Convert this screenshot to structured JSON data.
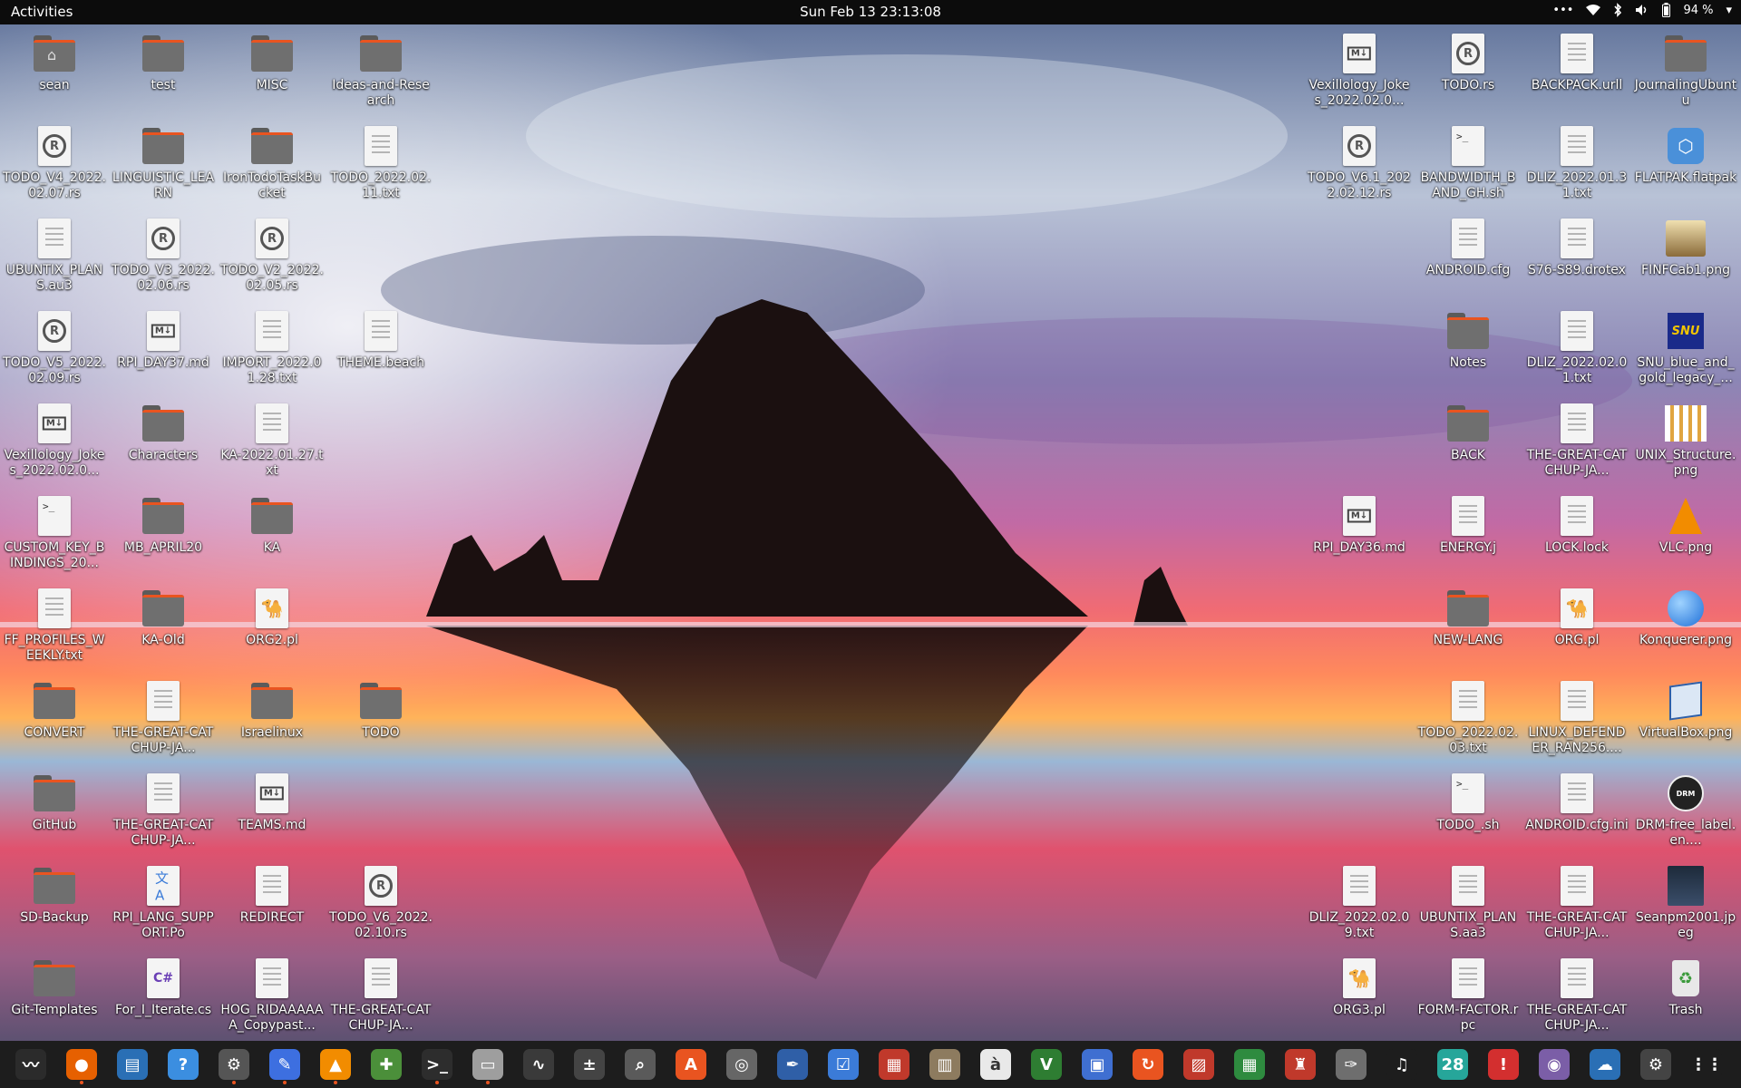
{
  "topbar": {
    "activities": "Activities",
    "clock": "Sun Feb 13  23:13:08",
    "battery_pct": "94 %"
  },
  "desktop_icons": [
    {
      "label": "sean",
      "kind": "home",
      "col": 0,
      "row": 0
    },
    {
      "label": "test",
      "kind": "folder",
      "col": 1,
      "row": 0
    },
    {
      "label": "MISC",
      "kind": "folder",
      "col": 2,
      "row": 0
    },
    {
      "label": "Ideas-and-Research",
      "kind": "folder",
      "col": 3,
      "row": 0
    },
    {
      "label": "TODO_V4_2022.02.07.rs",
      "kind": "rust",
      "col": 0,
      "row": 1
    },
    {
      "label": "LINGUISTIC_LEARN",
      "kind": "folder",
      "col": 1,
      "row": 1
    },
    {
      "label": "IronTodoTaskBucket",
      "kind": "folder",
      "col": 2,
      "row": 1
    },
    {
      "label": "TODO_2022.02.11.txt",
      "kind": "text",
      "col": 3,
      "row": 1
    },
    {
      "label": "UBUNTIX_PLANS.au3",
      "kind": "text",
      "col": 0,
      "row": 2
    },
    {
      "label": "TODO_V3_2022.02.06.rs",
      "kind": "rust",
      "col": 1,
      "row": 2
    },
    {
      "label": "TODO_V2_2022.02.05.rs",
      "kind": "rust",
      "col": 2,
      "row": 2
    },
    {
      "label": "TODO_V5_2022.02.09.rs",
      "kind": "rust",
      "col": 0,
      "row": 3
    },
    {
      "label": "RPI_DAY37.md",
      "kind": "markdown",
      "col": 1,
      "row": 3
    },
    {
      "label": "IMPORT_2022.01.28.txt",
      "kind": "text",
      "col": 2,
      "row": 3
    },
    {
      "label": "THEME.beach",
      "kind": "text",
      "col": 3,
      "row": 3
    },
    {
      "label": "Vexillology_Jokes_2022.02.0...",
      "kind": "markdown",
      "col": 0,
      "row": 4
    },
    {
      "label": "Characters",
      "kind": "folder",
      "col": 1,
      "row": 4
    },
    {
      "label": "KA-2022.01.27.txt",
      "kind": "text",
      "col": 2,
      "row": 4
    },
    {
      "label": "CUSTOM_KEY_BINDINGS_20...",
      "kind": "script",
      "col": 0,
      "row": 5
    },
    {
      "label": "MB_APRIL20",
      "kind": "folder",
      "col": 1,
      "row": 5
    },
    {
      "label": "KA",
      "kind": "folder",
      "col": 2,
      "row": 5
    },
    {
      "label": "FF_PROFILES_WEEKLY.txt",
      "kind": "text",
      "col": 0,
      "row": 6
    },
    {
      "label": "KA-Old",
      "kind": "folder",
      "col": 1,
      "row": 6
    },
    {
      "label": "ORG2.pl",
      "kind": "perl",
      "col": 2,
      "row": 6
    },
    {
      "label": "CONVERT",
      "kind": "folder",
      "col": 0,
      "row": 7
    },
    {
      "label": "THE-GREAT-CATCHUP-JA...",
      "kind": "text",
      "col": 1,
      "row": 7
    },
    {
      "label": "Israelinux",
      "kind": "folder",
      "col": 2,
      "row": 7
    },
    {
      "label": "TODO",
      "kind": "folder",
      "col": 3,
      "row": 7
    },
    {
      "label": "GitHub",
      "kind": "folder",
      "col": 0,
      "row": 8
    },
    {
      "label": "THE-GREAT-CATCHUP-JA...",
      "kind": "text",
      "col": 1,
      "row": 8
    },
    {
      "label": "TEAMS.md",
      "kind": "markdown",
      "col": 2,
      "row": 8
    },
    {
      "label": "SD-Backup",
      "kind": "folder",
      "col": 0,
      "row": 9
    },
    {
      "label": "RPI_LANG_SUPPORT.Po",
      "kind": "translate",
      "col": 1,
      "row": 9
    },
    {
      "label": "REDIRECT",
      "kind": "text",
      "col": 2,
      "row": 9
    },
    {
      "label": "TODO_V6_2022.02.10.rs",
      "kind": "rust",
      "col": 3,
      "row": 9
    },
    {
      "label": "Git-Templates",
      "kind": "folder",
      "col": 0,
      "row": 10
    },
    {
      "label": "For_I_Iterate.cs",
      "kind": "csharp",
      "col": 1,
      "row": 10
    },
    {
      "label": "HOG_RIDAAAAAA_Copypast...",
      "kind": "text",
      "col": 2,
      "row": 10
    },
    {
      "label": "THE-GREAT-CATCHUP-JA...",
      "kind": "text",
      "col": 3,
      "row": 10
    },
    {
      "label": "Vexillology_Jokes_2022.02.0...",
      "kind": "markdown",
      "col": 12,
      "row": 0
    },
    {
      "label": "TODO.rs",
      "kind": "rust",
      "col": 13,
      "row": 0
    },
    {
      "label": "BACKPACK.urll",
      "kind": "text",
      "col": 14,
      "row": 0
    },
    {
      "label": "JournalingUbuntu",
      "kind": "folder",
      "col": 15,
      "row": 0
    },
    {
      "label": "TODO_V6.1_2022.02.12.rs",
      "kind": "rust",
      "col": 12,
      "row": 1
    },
    {
      "label": "BANDWIDTH_BAND_GH.sh",
      "kind": "script",
      "col": 13,
      "row": 1
    },
    {
      "label": "DLIZ_2022.01.31.txt",
      "kind": "text",
      "col": 14,
      "row": 1
    },
    {
      "label": "FLATPAK.flatpak",
      "kind": "flatpak",
      "col": 15,
      "row": 1
    },
    {
      "label": "ANDROID.cfg",
      "kind": "text",
      "col": 13,
      "row": 2
    },
    {
      "label": "S76-S89.drotex",
      "kind": "text",
      "col": 14,
      "row": 2
    },
    {
      "label": "FINFCab1.png",
      "kind": "image-cab",
      "col": 15,
      "row": 2
    },
    {
      "label": "Notes",
      "kind": "folder",
      "col": 13,
      "row": 3
    },
    {
      "label": "DLIZ_2022.02.01.txt",
      "kind": "text",
      "col": 14,
      "row": 3
    },
    {
      "label": "SNU_blue_and_gold_legacy_...",
      "kind": "image-snu",
      "col": 15,
      "row": 3
    },
    {
      "label": "BACK",
      "kind": "folder",
      "col": 13,
      "row": 4
    },
    {
      "label": "THE-GREAT-CATCHUP-JA...",
      "kind": "text",
      "col": 14,
      "row": 4
    },
    {
      "label": "UNIX_Structure.png",
      "kind": "image-unix",
      "col": 15,
      "row": 4
    },
    {
      "label": "RPI_DAY36.md",
      "kind": "markdown",
      "col": 12,
      "row": 5
    },
    {
      "label": "ENERGY.j",
      "kind": "text",
      "col": 13,
      "row": 5
    },
    {
      "label": "LOCK.lock",
      "kind": "text",
      "col": 14,
      "row": 5
    },
    {
      "label": "VLC.png",
      "kind": "image-vlc",
      "col": 15,
      "row": 5
    },
    {
      "label": "NEW-LANG",
      "kind": "folder",
      "col": 13,
      "row": 6
    },
    {
      "label": "ORG.pl",
      "kind": "perl",
      "col": 14,
      "row": 6
    },
    {
      "label": "Konquerer.png",
      "kind": "image-konq",
      "col": 15,
      "row": 6
    },
    {
      "label": "TODO_2022.02.03.txt",
      "kind": "text",
      "col": 13,
      "row": 7
    },
    {
      "label": "LINUX_DEFENDER_RAN256....",
      "kind": "text",
      "col": 14,
      "row": 7
    },
    {
      "label": "VirtualBox.png",
      "kind": "image-vbox",
      "col": 15,
      "row": 7
    },
    {
      "label": "TODO_.sh",
      "kind": "script",
      "col": 13,
      "row": 8
    },
    {
      "label": "ANDROID.cfg.ini",
      "kind": "text",
      "col": 14,
      "row": 8
    },
    {
      "label": "DRM-free_label.en....",
      "kind": "image-drm",
      "col": 15,
      "row": 8
    },
    {
      "label": "DLIZ_2022.02.09.txt",
      "kind": "text",
      "col": 12,
      "row": 9
    },
    {
      "label": "UBUNTIX_PLANS.aa3",
      "kind": "text",
      "col": 13,
      "row": 9
    },
    {
      "label": "THE-GREAT-CATCHUP-JA...",
      "kind": "text",
      "col": 14,
      "row": 9
    },
    {
      "label": "Seanpm2001.jpeg",
      "kind": "image-photo",
      "col": 15,
      "row": 9
    },
    {
      "label": "ORG3.pl",
      "kind": "perl",
      "col": 12,
      "row": 10
    },
    {
      "label": "FORM-FACTOR.rpc",
      "kind": "text",
      "col": 13,
      "row": 10
    },
    {
      "label": "THE-GREAT-CATCHUP-JA...",
      "kind": "text",
      "col": 14,
      "row": 10
    },
    {
      "label": "Trash",
      "kind": "trash",
      "col": 15,
      "row": 10
    }
  ],
  "dock": [
    {
      "name": "system-monitor-icon",
      "glyph": "〰",
      "color": "#2b2b2b",
      "running": false
    },
    {
      "name": "firefox-icon",
      "glyph": "●",
      "color": "#e66000",
      "running": true
    },
    {
      "name": "text-editor-app-icon",
      "glyph": "▤",
      "color": "#2a6fb5",
      "running": false
    },
    {
      "name": "help-icon",
      "glyph": "?",
      "color": "#3b8ee0",
      "running": false
    },
    {
      "name": "settings-icon",
      "glyph": "⚙",
      "color": "#555555",
      "running": true
    },
    {
      "name": "gedit-icon",
      "glyph": "✎",
      "color": "#3d6fe0",
      "running": true
    },
    {
      "name": "vlc-icon",
      "glyph": "▲",
      "color": "#f28c00",
      "running": true
    },
    {
      "name": "puzzle-icon",
      "glyph": "✚",
      "color": "#4b8f3a",
      "running": false
    },
    {
      "name": "terminal-icon",
      "glyph": ">_",
      "color": "#2d2d2d",
      "running": true
    },
    {
      "name": "files-icon",
      "glyph": "▭",
      "color": "#9e9e9e",
      "running": true
    },
    {
      "name": "graph-icon",
      "glyph": "∿",
      "color": "#3a3a3a",
      "running": false
    },
    {
      "name": "calculator-icon",
      "glyph": "±",
      "color": "#444444",
      "running": false
    },
    {
      "name": "image-viewer-icon",
      "glyph": "⌕",
      "color": "#5a5a5a",
      "running": false
    },
    {
      "name": "software-center-icon",
      "glyph": "A",
      "color": "#e95420",
      "running": false
    },
    {
      "name": "disc-icon",
      "glyph": "◎",
      "color": "#666666",
      "running": false
    },
    {
      "name": "writer-icon",
      "glyph": "✒",
      "color": "#2f5fa7",
      "running": false
    },
    {
      "name": "tasks-icon",
      "glyph": "☑",
      "color": "#3b7bd8",
      "running": false
    },
    {
      "name": "presentation-icon",
      "glyph": "▦",
      "color": "#c0392b",
      "running": false
    },
    {
      "name": "archive-icon",
      "glyph": "▥",
      "color": "#8d7b5f",
      "running": false
    },
    {
      "name": "character-map-icon",
      "glyph": "à",
      "color": "#e9e9e9",
      "running": false
    },
    {
      "name": "vim-icon",
      "glyph": "V",
      "color": "#2e7d32",
      "running": false
    },
    {
      "name": "remote-desktop-icon",
      "glyph": "▣",
      "color": "#3f6fd1",
      "running": false
    },
    {
      "name": "update-icon",
      "glyph": "↻",
      "color": "#e95420",
      "running": false
    },
    {
      "name": "document-viewer-icon",
      "glyph": "▨",
      "color": "#c0392b",
      "running": false
    },
    {
      "name": "spreadsheet-icon",
      "glyph": "▦",
      "color": "#2e8b3f",
      "running": false
    },
    {
      "name": "mario-icon",
      "glyph": "♜",
      "color": "#c0392b",
      "running": false
    },
    {
      "name": "gimp-icon",
      "glyph": "✑",
      "color": "#6e6e6e",
      "running": false
    },
    {
      "name": "music-icon",
      "glyph": "♫",
      "color": "#1d1d1d",
      "running": false
    },
    {
      "name": "calendar-icon",
      "glyph": "28",
      "color": "#26a69a",
      "running": false
    },
    {
      "name": "alert-icon",
      "glyph": "!",
      "color": "#d32f2f",
      "running": false
    },
    {
      "name": "screenshot-icon",
      "glyph": "◉",
      "color": "#7b5ea7",
      "running": false
    },
    {
      "name": "weather-icon",
      "glyph": "☁",
      "color": "#2a6fb5",
      "running": false
    },
    {
      "name": "gear-app-icon",
      "glyph": "⚙",
      "color": "#444444",
      "running": false
    },
    {
      "name": "show-apps-icon",
      "glyph": "⋮⋮",
      "color": "#1d1d1d",
      "running": false
    }
  ],
  "colors": {
    "accent": "#e95420",
    "topbar": "#0c0c0c",
    "dock": "#1d1d1d"
  }
}
